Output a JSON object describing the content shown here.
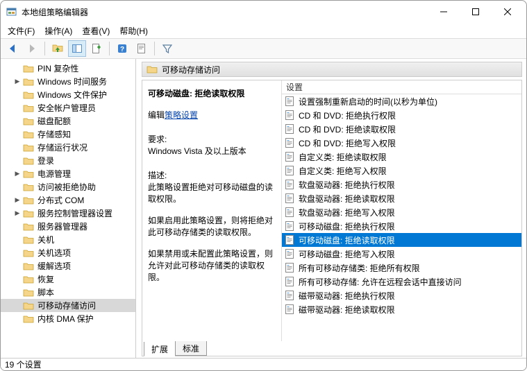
{
  "window": {
    "title": "本地组策略编辑器"
  },
  "menu": {
    "file": "文件(F)",
    "action": "操作(A)",
    "view": "查看(V)",
    "help": "帮助(H)"
  },
  "tree": {
    "items": [
      {
        "label": "PIN 复杂性",
        "expandable": false
      },
      {
        "label": "Windows 时间服务",
        "expandable": true
      },
      {
        "label": "Windows 文件保护",
        "expandable": false
      },
      {
        "label": "安全帐户管理员",
        "expandable": false
      },
      {
        "label": "磁盘配额",
        "expandable": false
      },
      {
        "label": "存储感知",
        "expandable": false
      },
      {
        "label": "存储运行状况",
        "expandable": false
      },
      {
        "label": "登录",
        "expandable": false
      },
      {
        "label": "电源管理",
        "expandable": true
      },
      {
        "label": "访问被拒绝协助",
        "expandable": false
      },
      {
        "label": "分布式 COM",
        "expandable": true
      },
      {
        "label": "服务控制管理器设置",
        "expandable": true
      },
      {
        "label": "服务器管理器",
        "expandable": false
      },
      {
        "label": "关机",
        "expandable": false
      },
      {
        "label": "关机选项",
        "expandable": false
      },
      {
        "label": "缓解选项",
        "expandable": false
      },
      {
        "label": "恢复",
        "expandable": false
      },
      {
        "label": "脚本",
        "expandable": false
      },
      {
        "label": "可移动存储访问",
        "expandable": false,
        "selected": true
      },
      {
        "label": "内核 DMA 保护",
        "expandable": false
      }
    ]
  },
  "right": {
    "header": "可移动存储访问",
    "detail": {
      "selected_title": "可移动磁盘: 拒绝读取权限",
      "edit_prefix": "编辑",
      "edit_link": "策略设置",
      "req_label": "要求:",
      "req_text": "Windows Vista 及以上版本",
      "desc_label": "描述:",
      "desc_p1": "此策略设置拒绝对可移动磁盘的读取权限。",
      "desc_p2": "如果启用此策略设置，则将拒绝对此可移动存储类的读取权限。",
      "desc_p3": "如果禁用或未配置此策略设置，则允许对此可移动存储类的读取权限。"
    },
    "list_header": "设置",
    "settings": [
      {
        "label": "设置强制重新启动的时间(以秒为单位)"
      },
      {
        "label": "CD 和 DVD: 拒绝执行权限"
      },
      {
        "label": "CD 和 DVD: 拒绝读取权限"
      },
      {
        "label": "CD 和 DVD: 拒绝写入权限"
      },
      {
        "label": "自定义类: 拒绝读取权限"
      },
      {
        "label": "自定义类: 拒绝写入权限"
      },
      {
        "label": "软盘驱动器: 拒绝执行权限"
      },
      {
        "label": "软盘驱动器: 拒绝读取权限"
      },
      {
        "label": "软盘驱动器: 拒绝写入权限"
      },
      {
        "label": "可移动磁盘: 拒绝执行权限"
      },
      {
        "label": "可移动磁盘: 拒绝读取权限",
        "selected": true
      },
      {
        "label": "可移动磁盘: 拒绝写入权限"
      },
      {
        "label": "所有可移动存储类: 拒绝所有权限"
      },
      {
        "label": "所有可移动存储: 允许在远程会话中直接访问"
      },
      {
        "label": "磁带驱动器: 拒绝执行权限"
      },
      {
        "label": "磁带驱动器: 拒绝读取权限"
      }
    ],
    "tabs": {
      "extended": "扩展",
      "standard": "标准"
    }
  },
  "status": {
    "text": "19 个设置"
  }
}
